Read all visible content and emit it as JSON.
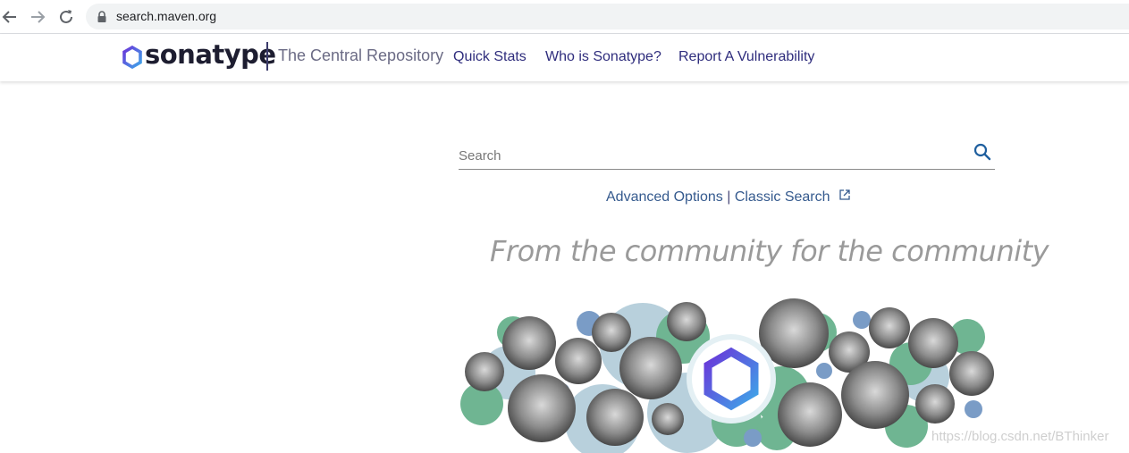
{
  "browser": {
    "url": "search.maven.org",
    "icons": [
      "back-arrow-icon",
      "forward-arrow-icon",
      "reload-icon",
      "lock-icon"
    ]
  },
  "header": {
    "logo_text": "sonatype",
    "repo_title": "The Central Repository",
    "nav": [
      {
        "label": "Quick Stats"
      },
      {
        "label": "Who is Sonatype?"
      },
      {
        "label": "Report A Vulnerability"
      }
    ]
  },
  "search": {
    "placeholder": "Search",
    "value": ""
  },
  "links": {
    "advanced": "Advanced Options",
    "separator": "|",
    "classic": "Classic Search"
  },
  "tagline": "From the community for the community",
  "watermark": "https://blog.csdn.net/BThinker",
  "colors": {
    "brand_purple": "#5b3bd6",
    "brand_blue": "#3ea6e8",
    "nav_link": "#2f2d7d",
    "link": "#355a8e",
    "green_bubble": "#6fb592",
    "blue_bubble": "#7a9cc6",
    "pale_bubble": "#b8d0dc"
  }
}
